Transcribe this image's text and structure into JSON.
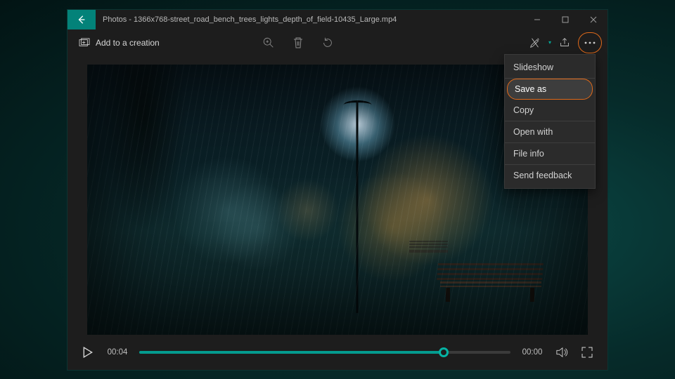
{
  "window": {
    "title": "Photos - 1366x768-street_road_bench_trees_lights_depth_of_field-10435_Large.mp4"
  },
  "toolbar": {
    "add_to_creation": "Add to a creation"
  },
  "menu": {
    "items": [
      {
        "label": "Slideshow",
        "selected": false
      },
      {
        "label": "Save as",
        "selected": true
      },
      {
        "label": "Copy",
        "selected": false
      },
      {
        "label": "Open with",
        "selected": false
      },
      {
        "label": "File info",
        "selected": false
      },
      {
        "label": "Send feedback",
        "selected": false
      }
    ]
  },
  "playback": {
    "elapsed": "00:04",
    "remaining": "00:00",
    "progress_pct": 82
  },
  "colors": {
    "accent": "#05b3a4",
    "highlight_border": "#e06a1a"
  }
}
